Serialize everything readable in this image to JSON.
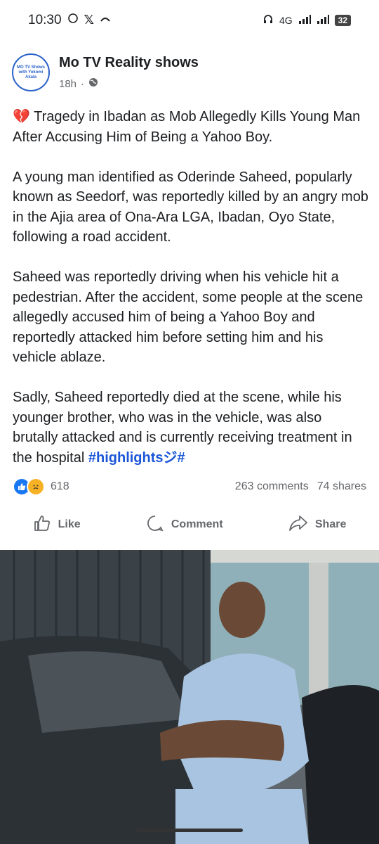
{
  "status_bar": {
    "time": "10:30",
    "network": "4G",
    "battery": "32"
  },
  "post": {
    "page_name": "Mo TV Reality shows",
    "timestamp": "18h",
    "avatar_text": "MO TV Shows with Yokomi Akala",
    "headline": "Tragedy in Ibadan as Mob Allegedly Kills Young Man After Accusing Him of Being a Yahoo Boy.",
    "paragraph_1": "A young man identified as Oderinde Saheed, popularly known as Seedorf, was reportedly killed by an angry mob in the Ajia area of Ona-Ara LGA, Ibadan, Oyo State, following a road accident.",
    "paragraph_2": "Saheed was reportedly driving when his vehicle hit a pedestrian. After the accident, some people at the scene allegedly accused him of being a Yahoo Boy and reportedly attacked him before setting him and his vehicle ablaze.",
    "paragraph_3": "Sadly, Saheed reportedly died at the scene, while his younger brother, who was in the vehicle, was also brutally attacked and is currently receiving treatment in the hospital",
    "hashtag": "#highlightsジ#"
  },
  "stats": {
    "reaction_count": "618",
    "comments": "263 comments",
    "shares": "74 shares"
  },
  "actions": {
    "like": "Like",
    "comment": "Comment",
    "share": "Share"
  },
  "colors": {
    "link": "#1b56d8",
    "like_blue": "#1877f2",
    "sad_yellow": "#f7b125"
  }
}
